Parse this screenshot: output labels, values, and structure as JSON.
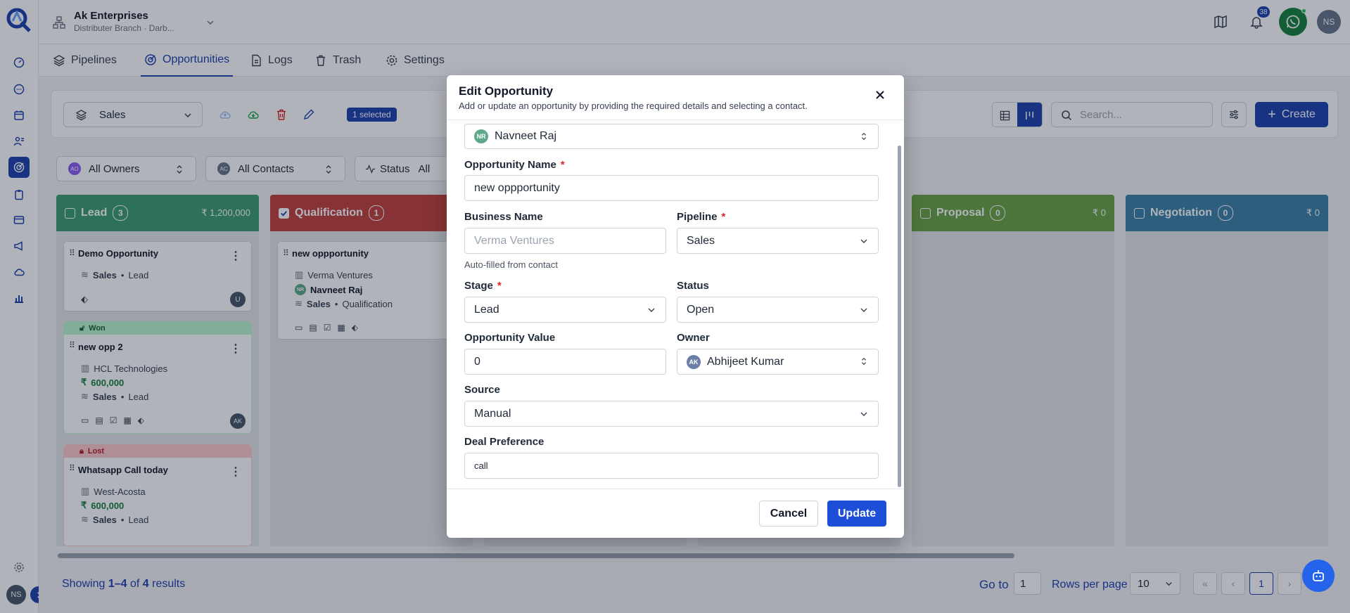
{
  "header": {
    "org_name": "Ak Enterprises",
    "branch": "Distributer Branch · Darb...",
    "notification_count": "38",
    "user_initials": "NS"
  },
  "tabs": [
    {
      "label": "Pipelines"
    },
    {
      "label": "Opportunities"
    },
    {
      "label": "Logs"
    },
    {
      "label": "Trash"
    },
    {
      "label": "Settings"
    }
  ],
  "toolbar": {
    "pipeline_select": "Sales",
    "selected_badge": "1 selected",
    "search_placeholder": "Search...",
    "create_label": "Create"
  },
  "filters": {
    "owners": "All Owners",
    "owners_badge": "AO",
    "contacts": "All Contacts",
    "contacts_badge": "AC",
    "status_label": "Status",
    "status_value": "All"
  },
  "columns": [
    {
      "name": "Lead",
      "count": "3",
      "total": "₹ 1,200,000",
      "color": "#3c9d6f"
    },
    {
      "name": "Qualification",
      "count": "1",
      "total": "",
      "color": "#c2413c"
    },
    {
      "name": "Proposal",
      "count": "0",
      "total": "₹ 0",
      "color": "#6aa343"
    },
    {
      "name": "Negotiation",
      "count": "0",
      "total": "₹ 0",
      "color": "#3c80a8"
    }
  ],
  "cards": {
    "c1": {
      "title": "Demo Opportunity",
      "pipeline": "Sales",
      "stage": "Lead",
      "avatar": "U"
    },
    "c2": {
      "tag": "Won",
      "title": "new opp 2",
      "company": "HCL Technologies",
      "amount": "600,000",
      "pipeline": "Sales",
      "stage": "Lead",
      "avatar": "AK"
    },
    "c3": {
      "tag": "Lost",
      "title": "Whatsapp Call today",
      "company": "West-Acosta",
      "amount": "600,000",
      "pipeline": "Sales",
      "stage": "Lead",
      "avatar": "AK"
    },
    "q1": {
      "title": "new oppportunity",
      "company": "Verma Ventures",
      "contact": "Navneet Raj",
      "contact_initials": "NR",
      "pipeline": "Sales",
      "stage": "Qualification"
    }
  },
  "modal": {
    "title": "Edit Opportunity",
    "subtitle": "Add or update an opportunity by providing the required details and selecting a contact.",
    "contact": {
      "initials": "NR",
      "value": "Navneet Raj"
    },
    "opportunity_name": {
      "label": "Opportunity Name",
      "value": "new oppportunity"
    },
    "business_name": {
      "label": "Business Name",
      "placeholder": "Verma Ventures",
      "hint": "Auto-filled from contact"
    },
    "pipeline": {
      "label": "Pipeline",
      "value": "Sales"
    },
    "stage": {
      "label": "Stage",
      "value": "Lead"
    },
    "status": {
      "label": "Status",
      "value": "Open"
    },
    "opportunity_value": {
      "label": "Opportunity Value",
      "value": "0"
    },
    "owner": {
      "label": "Owner",
      "initials": "AK",
      "value": "Abhijeet Kumar"
    },
    "source": {
      "label": "Source",
      "value": "Manual"
    },
    "deal_preference": {
      "label": "Deal Preference",
      "value": "call"
    },
    "required_mark": "*",
    "cancel_label": "Cancel",
    "update_label": "Update"
  },
  "footer": {
    "showing_prefix": "Showing ",
    "range": "1–4",
    "of_text": " of ",
    "total": "4",
    "results_text": " results",
    "goto_label": "Go to",
    "goto_value": "1",
    "rows_label": "Rows per page",
    "rows_value": "10",
    "current_page": "1"
  },
  "sidebar_user": "NS",
  "colors": {
    "primary": "#1e40af",
    "accent_green": "#16a34a",
    "danger": "#dc2626"
  }
}
